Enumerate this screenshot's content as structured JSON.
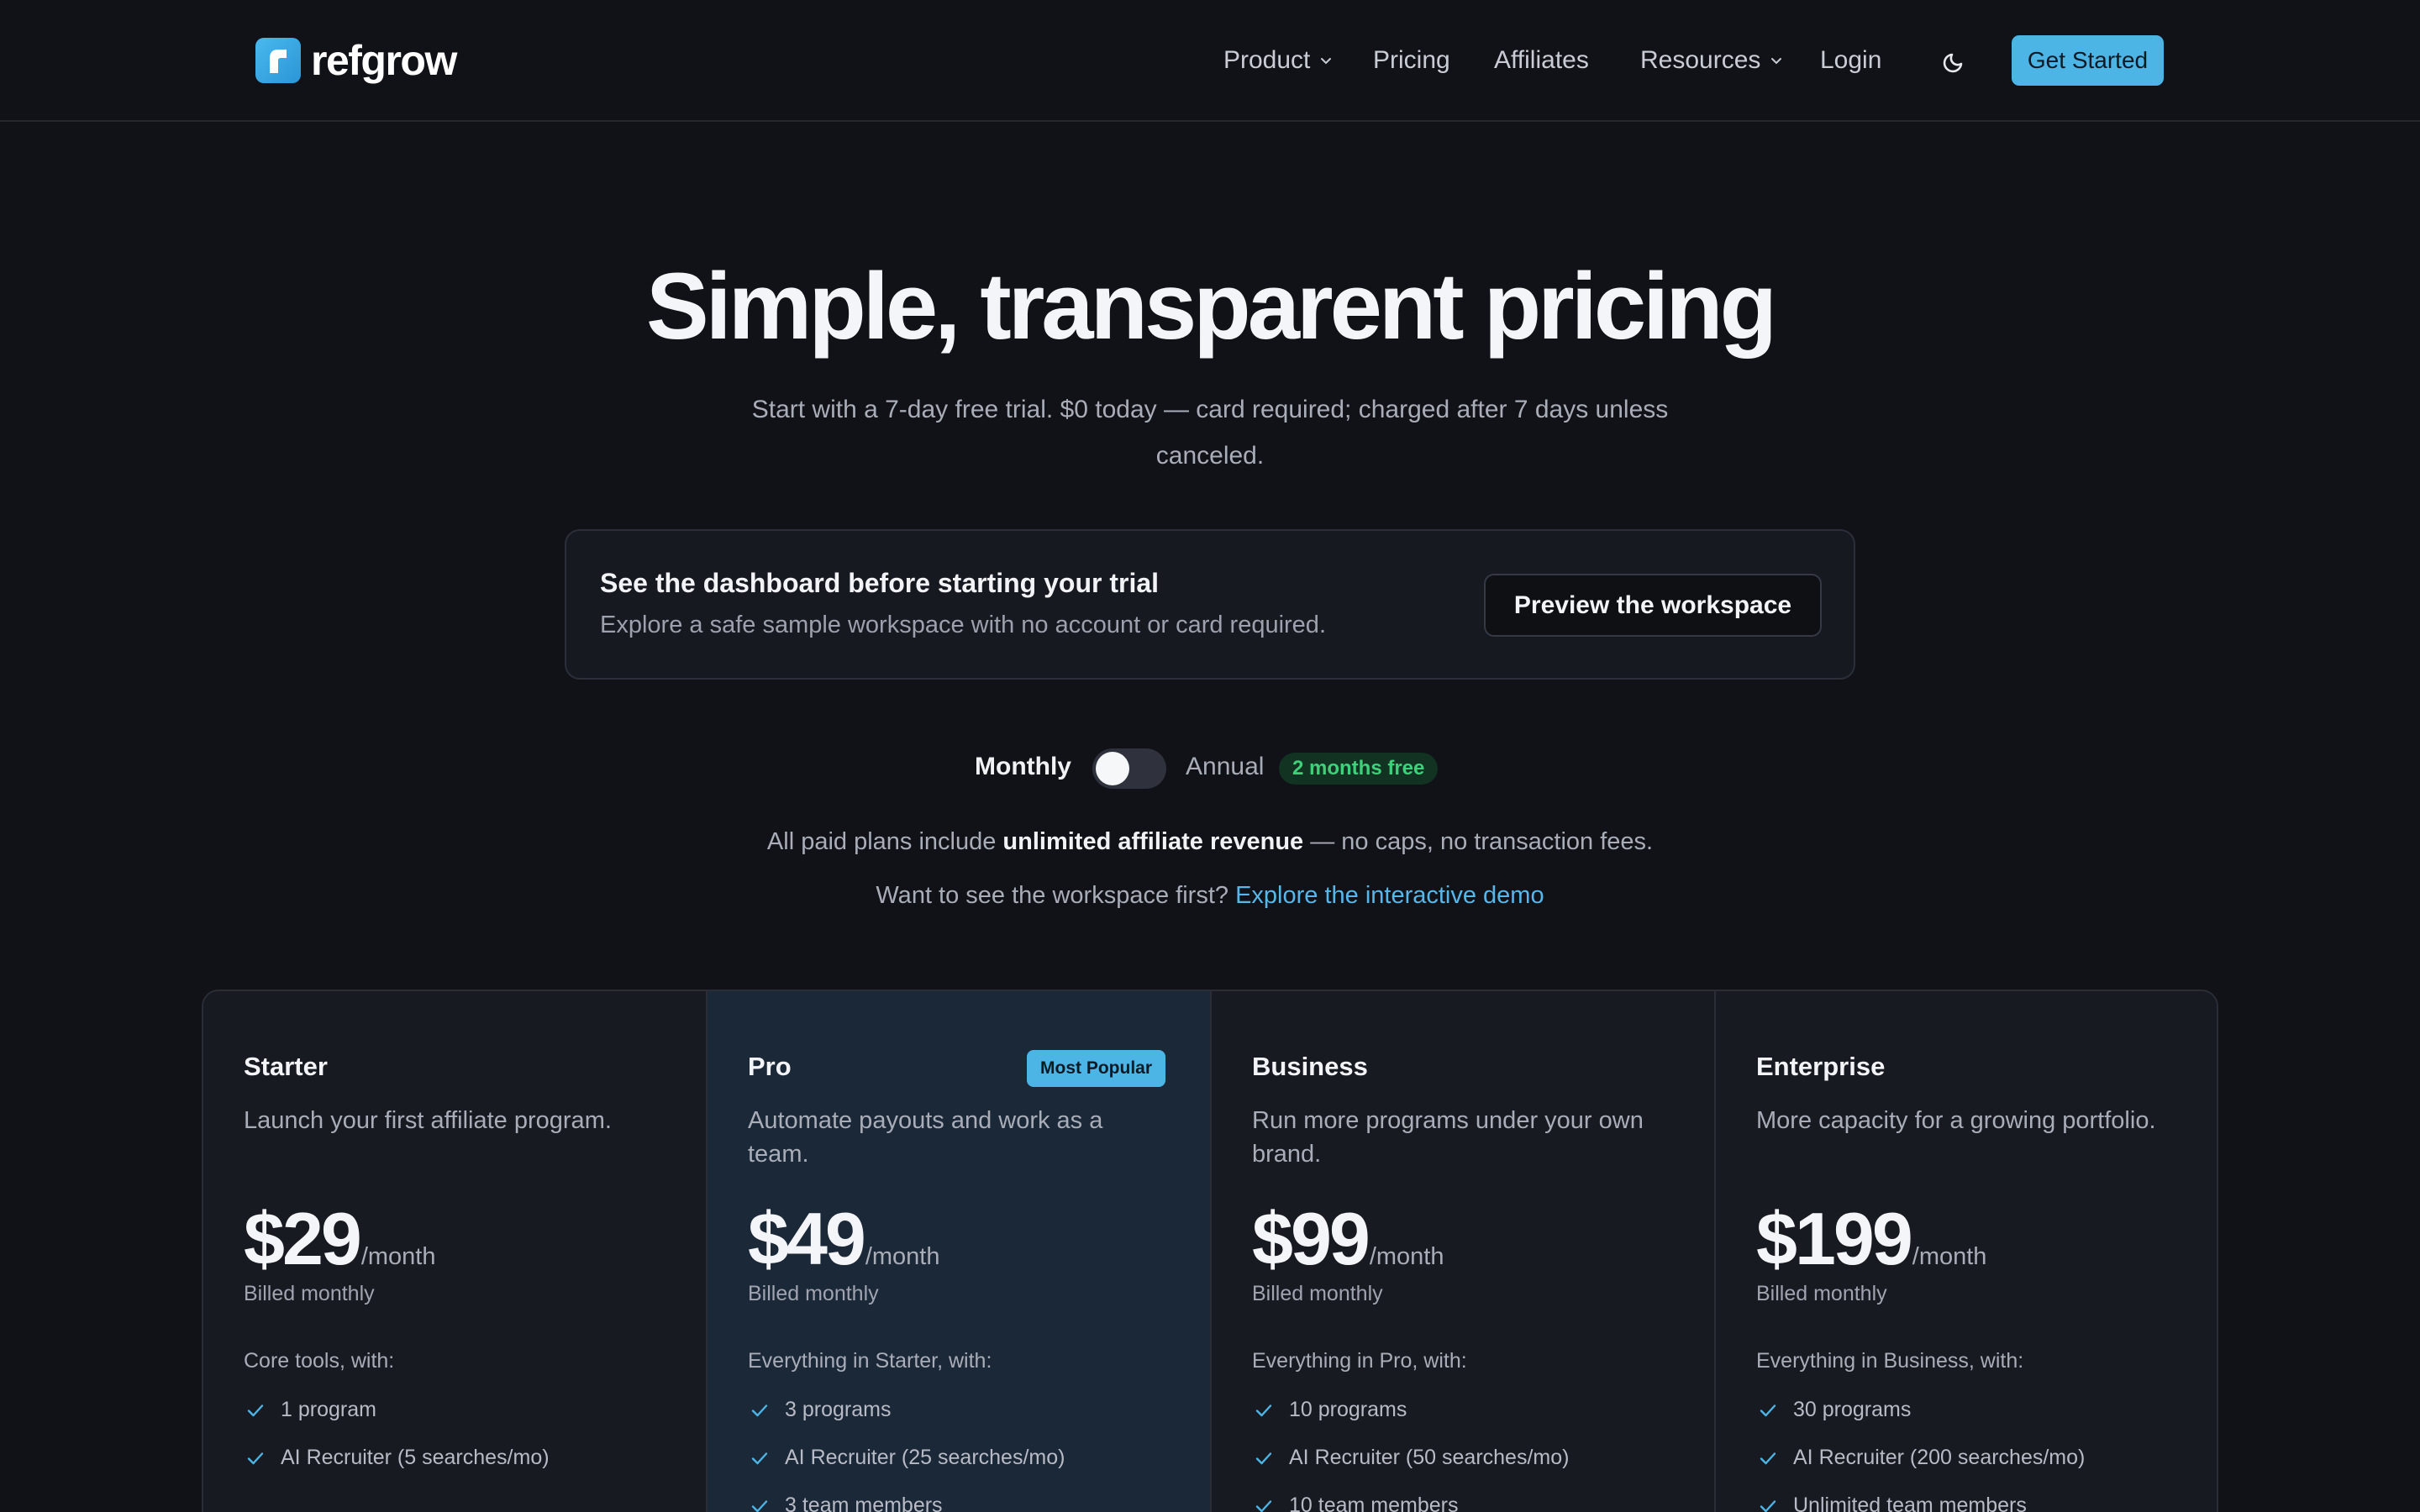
{
  "header": {
    "logo_text": "refgrow",
    "nav": {
      "product": "Product",
      "pricing": "Pricing",
      "affiliates": "Affiliates",
      "resources": "Resources",
      "login": "Login"
    },
    "cta": "Get Started"
  },
  "hero": {
    "title": "Simple, transparent pricing",
    "subtitle": "Start with a 7-day free trial. $0 today — card required; charged after 7 days unless canceled."
  },
  "preview": {
    "title": "See the dashboard before starting your trial",
    "text": "Explore a safe sample workspace with no account or card required.",
    "button": "Preview the workspace"
  },
  "billing": {
    "monthly": "Monthly",
    "annual": "Annual",
    "badge": "2 months free",
    "selected": "Monthly"
  },
  "note": {
    "prefix": "All paid plans include ",
    "bold": "unlimited affiliate revenue",
    "suffix": " — no caps, no transaction fees."
  },
  "demo": {
    "prefix": "Want to see the workspace first? ",
    "link": "Explore the interactive demo"
  },
  "plans": [
    {
      "name": "Starter",
      "badge": "",
      "description": "Launch your first affiliate program.",
      "price": "$29",
      "period": "/month",
      "billed": "Billed monthly",
      "includes": "Core tools, with:",
      "features": [
        "1 program",
        "AI Recruiter (5 searches/mo)"
      ]
    },
    {
      "name": "Pro",
      "badge": "Most Popular",
      "description": "Automate payouts and work as a team.",
      "price": "$49",
      "period": "/month",
      "billed": "Billed monthly",
      "includes": "Everything in Starter, with:",
      "features": [
        "3 programs",
        "AI Recruiter (25 searches/mo)",
        "3 team members"
      ]
    },
    {
      "name": "Business",
      "badge": "",
      "description": "Run more programs under your own brand.",
      "price": "$99",
      "period": "/month",
      "billed": "Billed monthly",
      "includes": "Everything in Pro, with:",
      "features": [
        "10 programs",
        "AI Recruiter (50 searches/mo)",
        "10 team members"
      ]
    },
    {
      "name": "Enterprise",
      "badge": "",
      "description": "More capacity for a growing portfolio.",
      "price": "$199",
      "period": "/month",
      "billed": "Billed monthly",
      "includes": "Everything in Business, with:",
      "features": [
        "30 programs",
        "AI Recruiter (200 searches/mo)",
        "Unlimited team members"
      ]
    }
  ],
  "colors": {
    "background": "#111217",
    "accent": "#4db4e6",
    "popular_card": "#1b2838",
    "success": "#3fd07a"
  },
  "icons": {
    "logo": "refgrow-logo-icon",
    "chevron": "chevron-down-icon",
    "theme": "moon-icon",
    "check": "check-icon"
  }
}
